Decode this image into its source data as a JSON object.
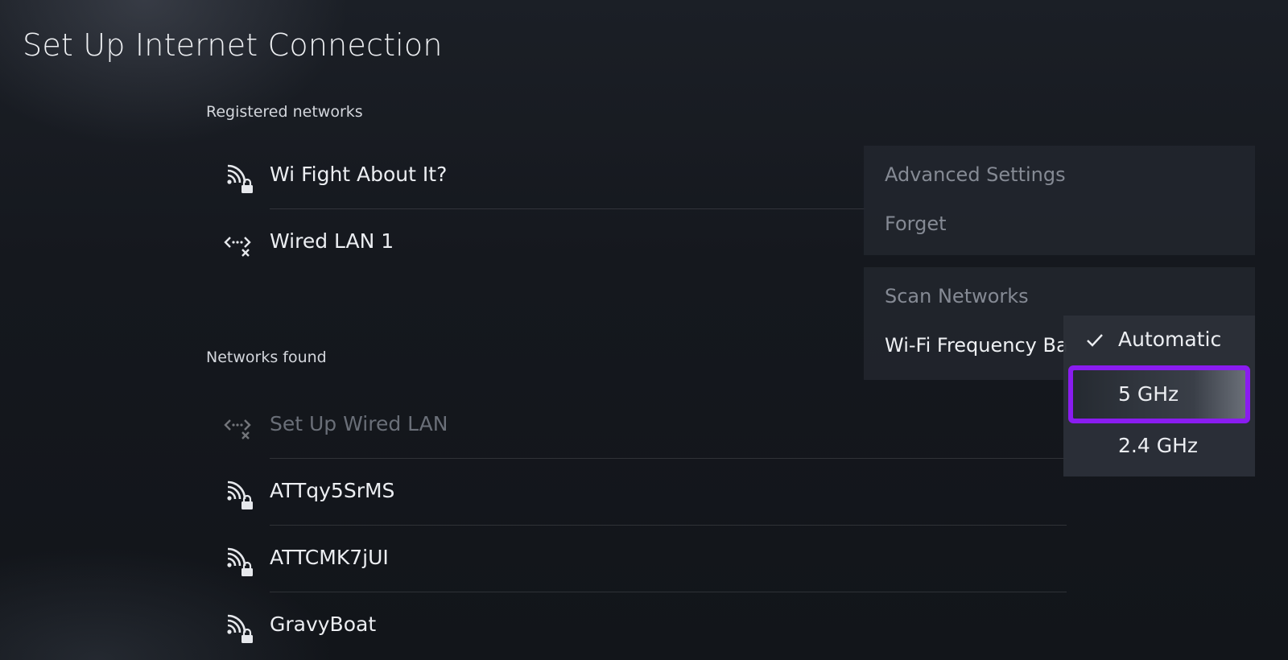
{
  "page": {
    "title": "Set Up Internet Connection"
  },
  "registered": {
    "label": "Registered networks",
    "networks": [
      {
        "name": "Wi Fight About It?",
        "icon": "wifi-locked-icon"
      },
      {
        "name": "Wired LAN 1",
        "icon": "wired-disconnected-icon"
      }
    ]
  },
  "found": {
    "label": "Networks found",
    "networks": [
      {
        "name": "Set Up Wired LAN",
        "icon": "wired-disconnected-icon",
        "disabled": true
      },
      {
        "name": "ATTqy5SrMS",
        "icon": "wifi-locked-icon"
      },
      {
        "name": "ATTCMK7jUI",
        "icon": "wifi-locked-icon"
      },
      {
        "name": "GravyBoat",
        "icon": "wifi-locked-icon"
      }
    ]
  },
  "options_menu": {
    "advanced_settings": "Advanced Settings",
    "forget": "Forget",
    "scan_networks": "Scan Networks",
    "wifi_frequency_band": "Wi-Fi Frequency Ba"
  },
  "frequency_dropdown": {
    "options": [
      "Automatic",
      "5 GHz",
      "2.4 GHz"
    ],
    "selected": "Automatic",
    "focused": "5 GHz"
  },
  "colors": {
    "focus_highlight": "#8a1cf0"
  }
}
